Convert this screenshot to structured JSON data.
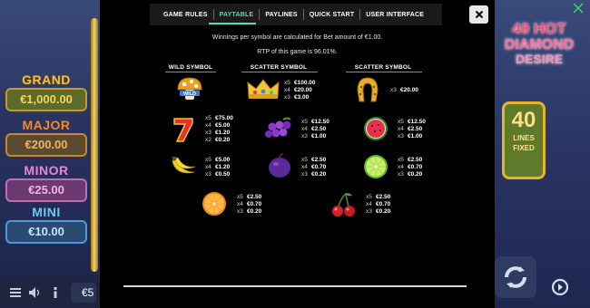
{
  "tabs": [
    {
      "label": "GAME RULES",
      "active": false
    },
    {
      "label": "PAYTABLE",
      "active": true
    },
    {
      "label": "PAYLINES",
      "active": false
    },
    {
      "label": "QUICK START",
      "active": false
    },
    {
      "label": "USER INTERFACE",
      "active": false
    }
  ],
  "info": {
    "bet_note": "Winnings per symbol are calculated for Bet amount of €1.00.",
    "rtp": "RTP of this game is 96.01%."
  },
  "columns": {
    "wild": "WILD SYMBOL",
    "scatter1": "SCATTER SYMBOL",
    "scatter2": "SCATTER SYMBOL"
  },
  "symbols": {
    "wild": {
      "icon": "mushroom-wild-icon",
      "pays": []
    },
    "crown": {
      "icon": "crown-scatter-icon",
      "pays": [
        {
          "m": "x5",
          "v": "€100.00"
        },
        {
          "m": "x4",
          "v": "€20.00"
        },
        {
          "m": "x3",
          "v": "€3.00"
        }
      ]
    },
    "horseshoe": {
      "icon": "horseshoe-scatter-icon",
      "pays": [
        {
          "m": "x3",
          "v": "€20.00"
        }
      ]
    },
    "seven": {
      "icon": "seven-icon",
      "pays": [
        {
          "m": "x5",
          "v": "€75.00"
        },
        {
          "m": "x4",
          "v": "€5.00"
        },
        {
          "m": "x3",
          "v": "€1.20"
        },
        {
          "m": "x2",
          "v": "€0.20"
        }
      ]
    },
    "grapes": {
      "icon": "grapes-icon",
      "pays": [
        {
          "m": "x5",
          "v": "€12.50"
        },
        {
          "m": "x4",
          "v": "€2.50"
        },
        {
          "m": "x3",
          "v": "€1.00"
        }
      ]
    },
    "watermelon": {
      "icon": "watermelon-icon",
      "pays": [
        {
          "m": "x5",
          "v": "€12.50"
        },
        {
          "m": "x4",
          "v": "€2.50"
        },
        {
          "m": "x3",
          "v": "€1.00"
        }
      ]
    },
    "banana": {
      "icon": "banana-icon",
      "pays": [
        {
          "m": "x5",
          "v": "€5.00"
        },
        {
          "m": "x4",
          "v": "€1.20"
        },
        {
          "m": "x3",
          "v": "€0.50"
        }
      ]
    },
    "plum": {
      "icon": "plum-icon",
      "pays": [
        {
          "m": "x5",
          "v": "€2.50"
        },
        {
          "m": "x4",
          "v": "€0.70"
        },
        {
          "m": "x3",
          "v": "€0.20"
        }
      ]
    },
    "lime": {
      "icon": "lime-icon",
      "pays": [
        {
          "m": "x5",
          "v": "€2.50"
        },
        {
          "m": "x4",
          "v": "€0.70"
        },
        {
          "m": "x3",
          "v": "€0.20"
        }
      ]
    },
    "orange": {
      "icon": "orange-icon",
      "pays": [
        {
          "m": "x5",
          "v": "€2.50"
        },
        {
          "m": "x4",
          "v": "€0.70"
        },
        {
          "m": "x3",
          "v": "€0.20"
        }
      ]
    },
    "cherry": {
      "icon": "cherry-icon",
      "pays": [
        {
          "m": "x5",
          "v": "€2.50"
        },
        {
          "m": "x4",
          "v": "€0.70"
        },
        {
          "m": "x3",
          "v": "€0.20"
        }
      ]
    }
  },
  "jackpots": [
    {
      "name": "GRAND",
      "amount": "€1,000.00"
    },
    {
      "name": "MAJOR",
      "amount": "€200.00"
    },
    {
      "name": "MINOR",
      "amount": "€25.00"
    },
    {
      "name": "MINI",
      "amount": "€10.00"
    }
  ],
  "logo": {
    "line1": "40 HOT",
    "line2": "DIAMOND",
    "line3": "DESIRE"
  },
  "lines_badge": {
    "number": "40",
    "line1": "LINES",
    "line2": "FIXED"
  },
  "bet_value": "€5",
  "colors": {
    "accent": "#4ee2b0",
    "panel": "#000000",
    "tabbar": "#1a1a1a"
  }
}
